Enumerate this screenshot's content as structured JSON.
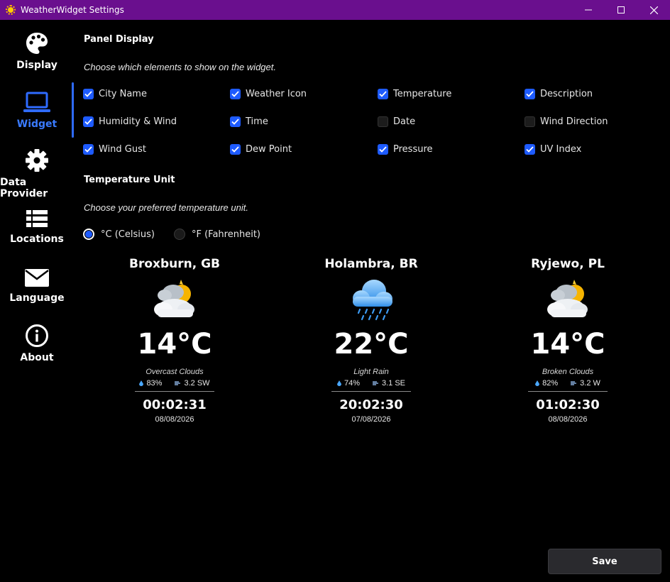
{
  "window": {
    "title": "WeatherWidget Settings",
    "titlebar_color": "#6a0f8e"
  },
  "sidebar": {
    "active_color": "#3a7bff",
    "items": [
      {
        "label": "Display",
        "icon": "palette-icon"
      },
      {
        "label": "Widget",
        "icon": "laptop-icon",
        "active": true
      },
      {
        "label": "Data Provider",
        "icon": "gear-icon"
      },
      {
        "label": "Locations",
        "icon": "list-icon"
      },
      {
        "label": "Language",
        "icon": "envelope-icon"
      },
      {
        "label": "About",
        "icon": "info-icon"
      }
    ]
  },
  "panel_display": {
    "title": "Panel Display",
    "description": "Choose which elements to show on the widget.",
    "options": [
      {
        "label": "City Name",
        "checked": true
      },
      {
        "label": "Weather Icon",
        "checked": true
      },
      {
        "label": "Temperature",
        "checked": true
      },
      {
        "label": "Description",
        "checked": true
      },
      {
        "label": "Humidity & Wind",
        "checked": true
      },
      {
        "label": "Time",
        "checked": true
      },
      {
        "label": "Date",
        "checked": false
      },
      {
        "label": "Wind Direction",
        "checked": false
      },
      {
        "label": "Wind Gust",
        "checked": true
      },
      {
        "label": "Dew Point",
        "checked": true
      },
      {
        "label": "Pressure",
        "checked": true
      },
      {
        "label": "UV Index",
        "checked": true
      }
    ]
  },
  "temperature_unit": {
    "title": "Temperature Unit",
    "description": "Choose your preferred temperature unit.",
    "options": [
      {
        "label": "°C (Celsius)",
        "selected": true
      },
      {
        "label": "°F (Fahrenheit)",
        "selected": false
      }
    ]
  },
  "preview": [
    {
      "city": "Broxburn, GB",
      "icon": "partly-cloudy-night-icon",
      "temp": "14°C",
      "description": "Overcast Clouds",
      "humidity": "83%",
      "wind": "3.2 SW",
      "time": "00:02:31",
      "date": "08/08/2026"
    },
    {
      "city": "Holambra, BR",
      "icon": "rain-cloud-icon",
      "temp": "22°C",
      "description": "Light Rain",
      "humidity": "74%",
      "wind": "3.1 SE",
      "time": "20:02:30",
      "date": "07/08/2026"
    },
    {
      "city": "Ryjewo, PL",
      "icon": "partly-cloudy-night-icon",
      "temp": "14°C",
      "description": "Broken Clouds",
      "humidity": "82%",
      "wind": "3.2 W",
      "time": "01:02:30",
      "date": "08/08/2026"
    }
  ],
  "footer": {
    "save_label": "Save"
  }
}
